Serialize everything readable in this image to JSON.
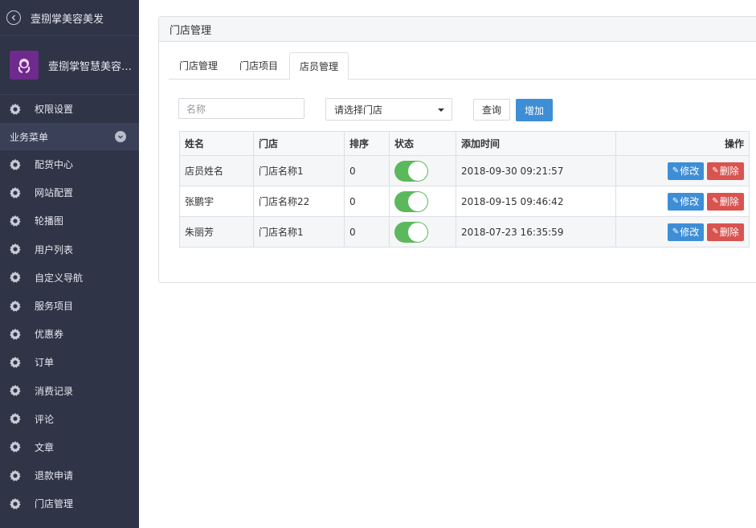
{
  "sidebar": {
    "top_title": "壹捌掌美容美发",
    "brand_name": "壹捌掌智慧美容美发",
    "permission_label": "权限设置",
    "group_label": "业务菜单",
    "items": [
      {
        "label": "配货中心"
      },
      {
        "label": "网站配置"
      },
      {
        "label": "轮播图"
      },
      {
        "label": "用户列表"
      },
      {
        "label": "自定义导航"
      },
      {
        "label": "服务项目"
      },
      {
        "label": "优惠券"
      },
      {
        "label": "订单"
      },
      {
        "label": "消费记录"
      },
      {
        "label": "评论"
      },
      {
        "label": "文章"
      },
      {
        "label": "退款申请"
      },
      {
        "label": "门店管理"
      }
    ]
  },
  "panel": {
    "title": "门店管理",
    "tabs": [
      {
        "label": "门店管理"
      },
      {
        "label": "门店项目"
      },
      {
        "label": "店员管理"
      }
    ]
  },
  "filters": {
    "name_placeholder": "名称",
    "store_select": "请选择门店",
    "query_label": "查询",
    "add_label": "增加"
  },
  "table": {
    "headers": [
      "姓名",
      "门店",
      "排序",
      "状态",
      "添加时间",
      "操作"
    ],
    "rows": [
      {
        "name": "店员姓名",
        "store": "门店名称1",
        "sort": "0",
        "added": "2018-09-30 09:21:57"
      },
      {
        "name": "张鹏宇",
        "store": "门店名称22",
        "sort": "0",
        "added": "2018-09-15 09:46:42"
      },
      {
        "name": "朱丽芳",
        "store": "门店名称1",
        "sort": "0",
        "added": "2018-07-23 16:35:59"
      }
    ],
    "edit_label": "修改",
    "delete_label": "删除"
  },
  "colors": {
    "sidebar_bg": "#2f3447",
    "primary": "#3d8ed6",
    "danger": "#d9534f",
    "toggle_on": "#5cb85c"
  }
}
